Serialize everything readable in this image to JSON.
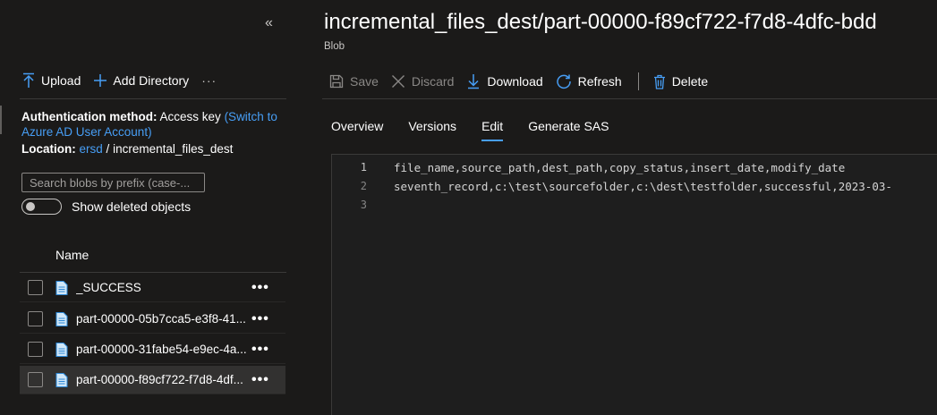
{
  "left_panel": {
    "collapse_glyph": "«",
    "toolbar": {
      "upload_label": "Upload",
      "add_directory_label": "Add Directory",
      "more_label": "···"
    },
    "auth": {
      "label": "Authentication method:",
      "value": "Access key",
      "switch_link": "(Switch to Azure AD User Account)"
    },
    "location": {
      "label": "Location:",
      "container": "ersd",
      "separator": "/",
      "folder": "incremental_files_dest"
    },
    "search": {
      "placeholder": "Search blobs by prefix (case-..."
    },
    "show_deleted": {
      "label": "Show deleted objects",
      "on": false
    },
    "list": {
      "header": "Name",
      "items": [
        {
          "name": "_SUCCESS",
          "selected": false,
          "more": "•••"
        },
        {
          "name": "part-00000-05b7cca5-e3f8-41...",
          "selected": false,
          "more": "•••"
        },
        {
          "name": "part-00000-31fabe54-e9ec-4a...",
          "selected": false,
          "more": "•••"
        },
        {
          "name": "part-00000-f89cf722-f7d8-4df...",
          "selected": true,
          "more": "•••"
        }
      ]
    }
  },
  "right_panel": {
    "title": "incremental_files_dest/part-00000-f89cf722-f7d8-4dfc-bdd",
    "subtitle": "Blob",
    "toolbar": {
      "save_label": "Save",
      "discard_label": "Discard",
      "download_label": "Download",
      "refresh_label": "Refresh",
      "delete_label": "Delete"
    },
    "tabs": [
      {
        "label": "Overview",
        "active": false
      },
      {
        "label": "Versions",
        "active": false
      },
      {
        "label": "Edit",
        "active": true
      },
      {
        "label": "Generate SAS",
        "active": false
      }
    ],
    "editor": {
      "lines": [
        {
          "number": "1",
          "text": "file_name,source_path,dest_path,copy_status,insert_date,modify_date"
        },
        {
          "number": "2",
          "text": "seventh_record,c:\\test\\sourcefolder,c:\\dest\\testfolder,successful,2023-03-"
        },
        {
          "number": "3",
          "text": ""
        }
      ]
    }
  },
  "colors": {
    "background": "#1b1a19",
    "accent": "#479ef5",
    "editor_background": "#1e1e1e",
    "selected_row": "#323130"
  }
}
